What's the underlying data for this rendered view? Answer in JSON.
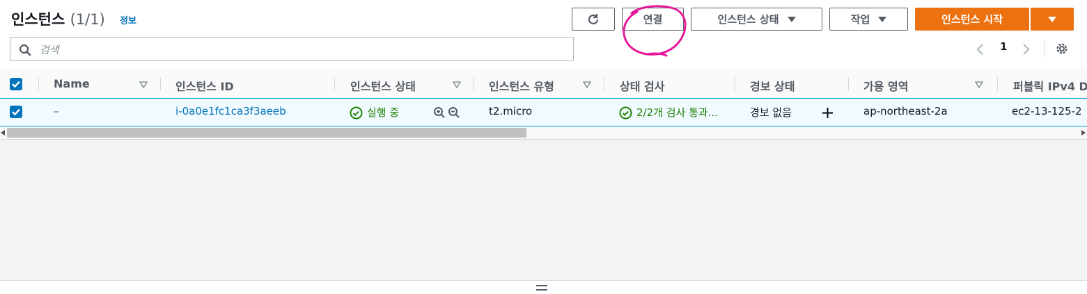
{
  "header": {
    "title": "인스턴스",
    "count": "(1/1)",
    "info_link": "정보"
  },
  "toolbar": {
    "connect_label": "연결",
    "instance_state_label": "인스턴스 상태",
    "actions_label": "작업",
    "launch_label": "인스턴스 시작"
  },
  "search": {
    "placeholder": "검색"
  },
  "pagination": {
    "current_page": "1"
  },
  "table": {
    "columns": [
      "Name",
      "인스턴스 ID",
      "인스턴스 상태",
      "인스턴스 유형",
      "상태 검사",
      "경보 상태",
      "가용 영역",
      "퍼블릭 IPv4 D"
    ],
    "rows": [
      {
        "name": "–",
        "instance_id": "i-0a0e1fc1ca3f3aeeb",
        "state": "실행 중",
        "type": "t2.micro",
        "status_check": "2/2개 검사 통과...",
        "alarm_status": "경보 없음",
        "az": "ap-northeast-2a",
        "public_dns": "ec2-13-125-2"
      }
    ]
  },
  "colors": {
    "primary_orange": "#ec7211",
    "link_blue": "#0073bb",
    "success_green": "#1d8102",
    "annotation_magenta": "#e6199b"
  }
}
